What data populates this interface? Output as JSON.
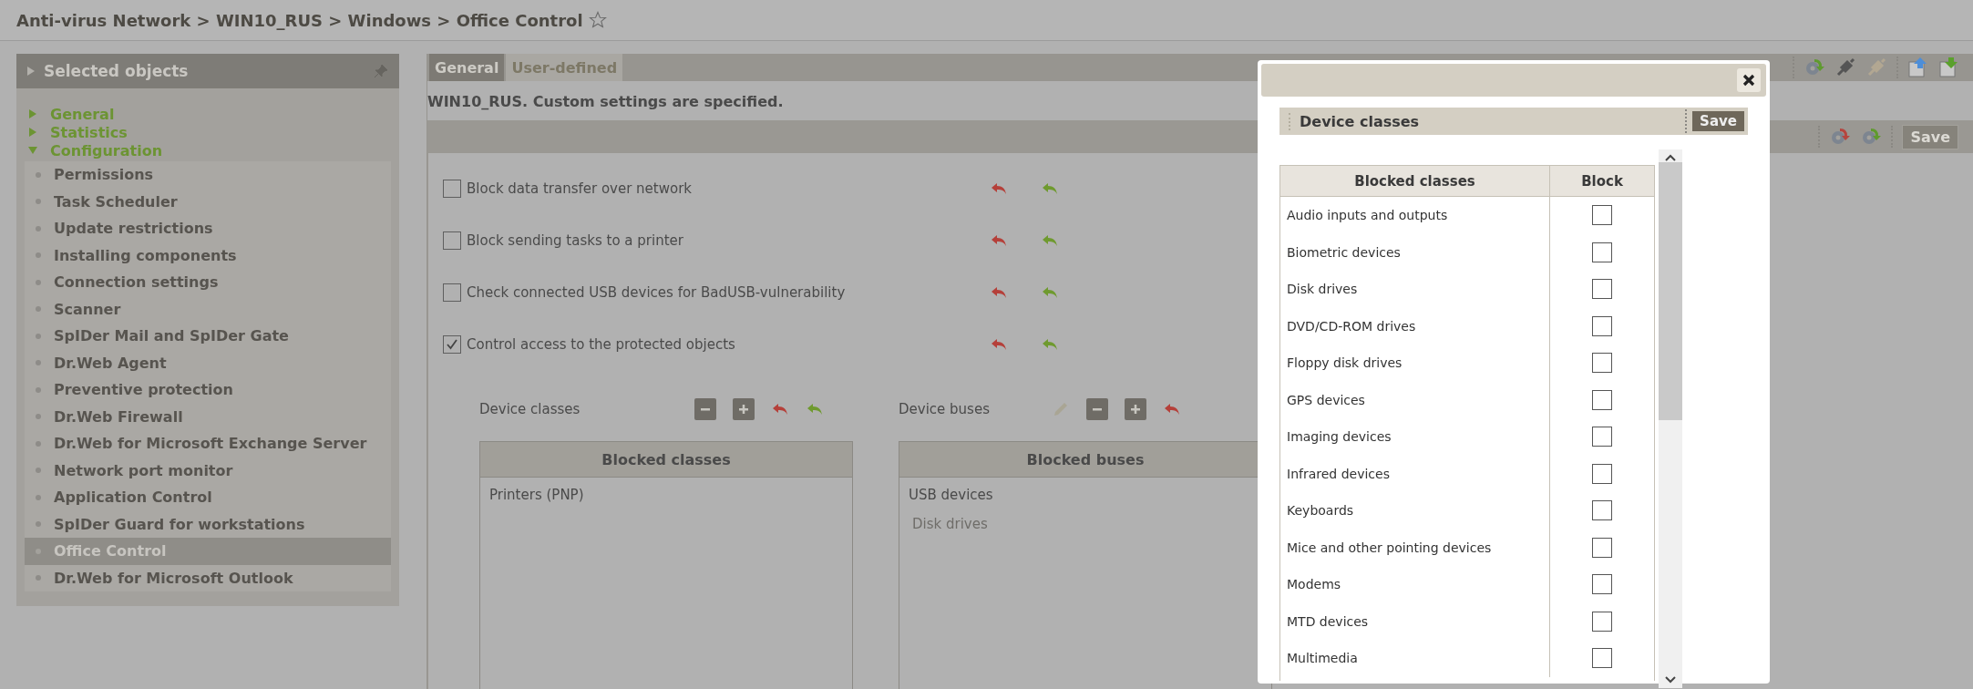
{
  "breadcrumb": {
    "path": "Anti-virus Network > WIN10_RUS > Windows > Office Control",
    "starred": false
  },
  "sidebar": {
    "header": "Selected objects",
    "sections": [
      {
        "label": "General",
        "expanded": false
      },
      {
        "label": "Statistics",
        "expanded": false
      },
      {
        "label": "Configuration",
        "expanded": true,
        "children": [
          {
            "label": "Permissions",
            "selected": false
          },
          {
            "label": "Task Scheduler",
            "selected": false
          },
          {
            "label": "Update restrictions",
            "selected": false
          },
          {
            "label": "Installing components",
            "selected": false
          },
          {
            "label": "Connection settings",
            "selected": false
          },
          {
            "label": "Scanner",
            "selected": false
          },
          {
            "label": "SpIDer Mail and SpIDer Gate",
            "selected": false
          },
          {
            "label": "Dr.Web Agent",
            "selected": false
          },
          {
            "label": "Preventive protection",
            "selected": false
          },
          {
            "label": "Dr.Web Firewall",
            "selected": false
          },
          {
            "label": "Dr.Web for Microsoft Exchange Server",
            "selected": false
          },
          {
            "label": "Network port monitor",
            "selected": false
          },
          {
            "label": "Application Control",
            "selected": false
          },
          {
            "label": "SpIDer Guard for workstations",
            "selected": false
          },
          {
            "label": "Office Control",
            "selected": true
          },
          {
            "label": "Dr.Web for Microsoft Outlook",
            "selected": false
          }
        ]
      }
    ]
  },
  "tabs": [
    {
      "label": "General",
      "selected": true
    },
    {
      "label": "User-defined",
      "selected": false
    }
  ],
  "status": "WIN10_RUS. Custom settings are specified.",
  "toolbar_save": {
    "label": "Save",
    "disabled": true
  },
  "options": [
    {
      "label": "Block data transfer over network",
      "checked": false
    },
    {
      "label": "Block sending tasks to a printer",
      "checked": false
    },
    {
      "label": "Check connected USB devices for BadUSB-vulnerability",
      "checked": false
    },
    {
      "label": "Control access to the protected objects",
      "checked": true
    }
  ],
  "device_classes": {
    "label": "Device classes",
    "header": "Blocked classes",
    "rows": [
      {
        "label": "Printers (PNP)"
      }
    ]
  },
  "device_buses": {
    "label": "Device buses",
    "header": "Blocked buses",
    "rows": [
      {
        "label": "USB devices",
        "children": [
          {
            "label": "Disk drives"
          }
        ]
      }
    ]
  },
  "dialog": {
    "title": "Device classes",
    "save": "Save",
    "columns": [
      "Blocked classes",
      "Block"
    ],
    "rows": [
      {
        "label": "Audio inputs and outputs",
        "checked": false
      },
      {
        "label": "Biometric devices",
        "checked": false
      },
      {
        "label": "Disk drives",
        "checked": false
      },
      {
        "label": "DVD/CD-ROM drives",
        "checked": false
      },
      {
        "label": "Floppy disk drives",
        "checked": false
      },
      {
        "label": "GPS devices",
        "checked": false
      },
      {
        "label": "Imaging devices",
        "checked": false
      },
      {
        "label": "Infrared devices",
        "checked": false
      },
      {
        "label": "Keyboards",
        "checked": false
      },
      {
        "label": "Mice and other pointing devices",
        "checked": false
      },
      {
        "label": "Modems",
        "checked": false
      },
      {
        "label": "MTD devices",
        "checked": false
      },
      {
        "label": "Multimedia",
        "checked": false
      }
    ]
  }
}
